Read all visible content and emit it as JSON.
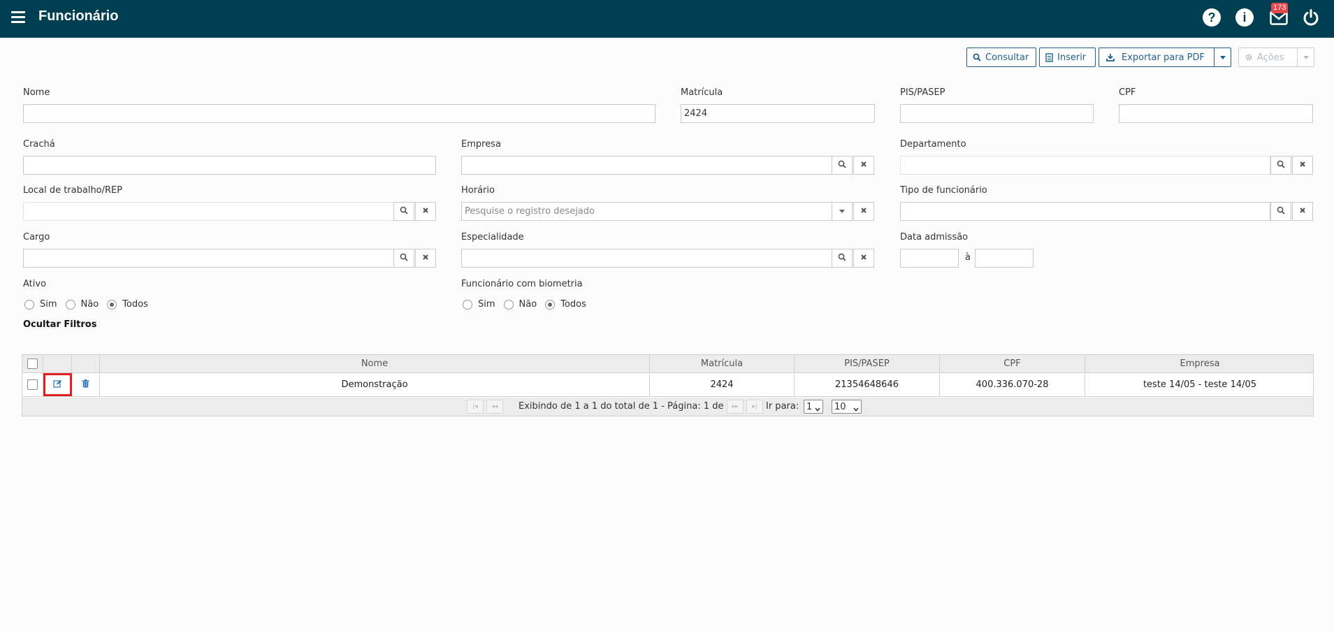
{
  "header": {
    "title": "Funcionário",
    "notifications_count": "173",
    "bg_color": "#003e52"
  },
  "toolbar": {
    "consultar": "Consultar",
    "inserir": "Inserir",
    "exportar": "Exportar para PDF",
    "acoes": "Ações"
  },
  "filters": {
    "nome": {
      "label": "Nome",
      "value": ""
    },
    "matricula": {
      "label": "Matrícula",
      "value": "2424"
    },
    "pis": {
      "label": "PIS/PASEP",
      "value": ""
    },
    "cpf": {
      "label": "CPF",
      "value": ""
    },
    "cracha": {
      "label": "Crachá",
      "value": ""
    },
    "empresa": {
      "label": "Empresa",
      "value": ""
    },
    "departamento": {
      "label": "Departamento",
      "value": ""
    },
    "local": {
      "label": "Local de trabalho/REP",
      "value": ""
    },
    "horario": {
      "label": "Horário",
      "value": "",
      "placeholder": "Pesquise o registro desejado"
    },
    "tipo": {
      "label": "Tipo de funcionário",
      "value": ""
    },
    "cargo": {
      "label": "Cargo",
      "value": ""
    },
    "especialidade": {
      "label": "Especialidade",
      "value": ""
    },
    "data_admissao": {
      "label": "Data admissão",
      "separator": "à",
      "from": "",
      "to": ""
    },
    "ativo": {
      "label": "Ativo",
      "options": [
        "Sim",
        "Não",
        "Todos"
      ],
      "selected": "Todos"
    },
    "biometria": {
      "label": "Funcionário com biometria",
      "options": [
        "Sim",
        "Não",
        "Todos"
      ],
      "selected": "Todos"
    },
    "toggle_label": "Ocultar Filtros"
  },
  "grid": {
    "columns": [
      "Nome",
      "Matrícula",
      "PIS/PASEP",
      "CPF",
      "Empresa"
    ],
    "rows": [
      [
        "Demonstração",
        "2424",
        "21354648646",
        "400.336.070-28",
        "teste 14/05 - teste 14/05"
      ]
    ],
    "pager": {
      "info": "Exibindo de 1 a 1 do total de 1 - Página: 1 de 1",
      "goto_label": "Ir para:",
      "page": "1",
      "page_size": "10"
    }
  }
}
